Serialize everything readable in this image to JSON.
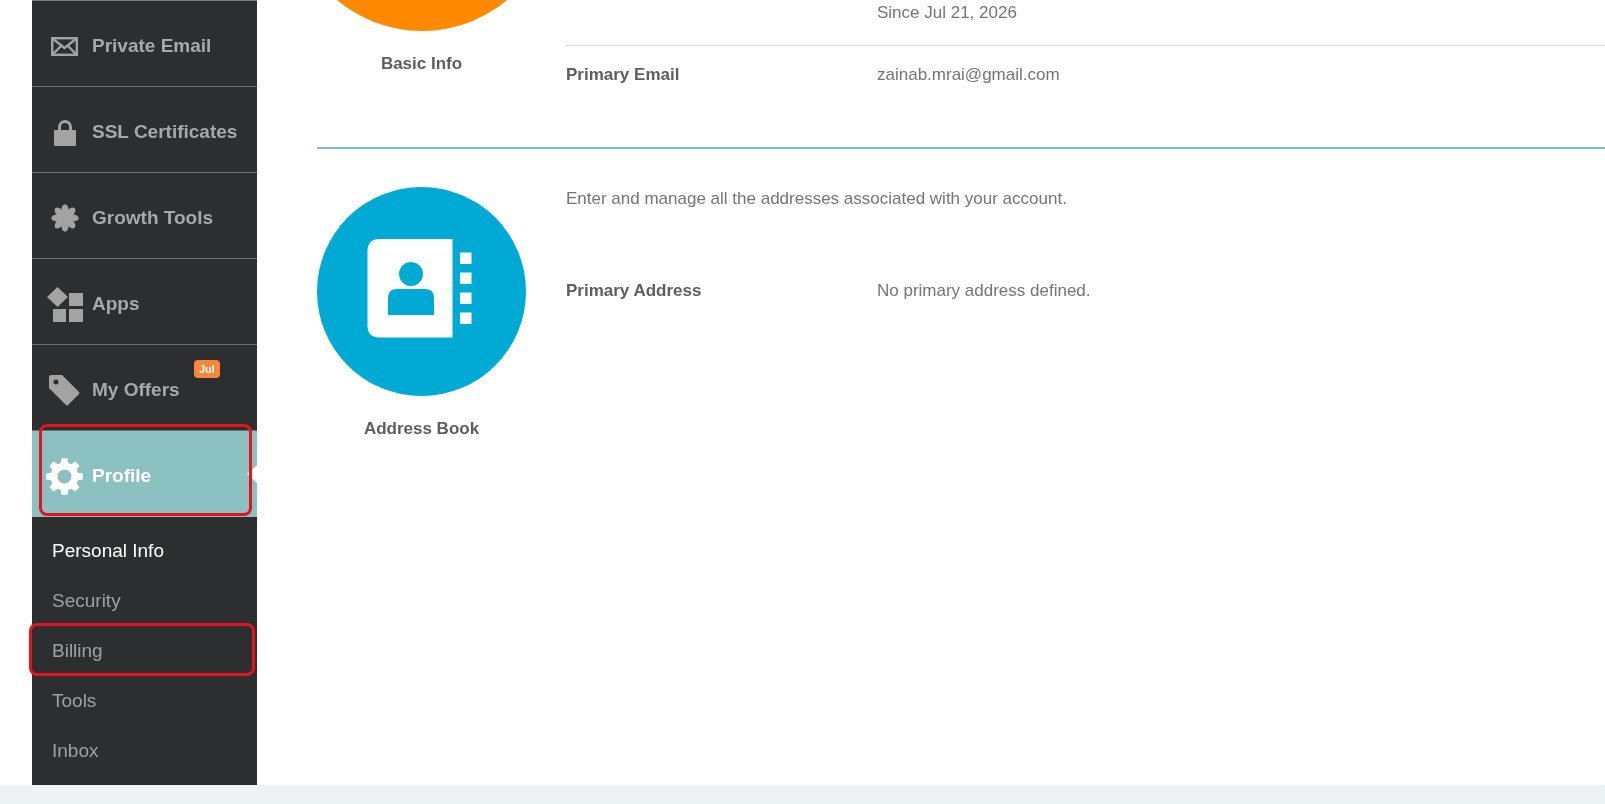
{
  "sidebar": {
    "items": [
      {
        "label": "Private Email",
        "selected": false,
        "highlighted": false
      },
      {
        "label": "SSL Certificates",
        "selected": false,
        "highlighted": false
      },
      {
        "label": "Growth Tools",
        "selected": false,
        "highlighted": false
      },
      {
        "label": "Apps",
        "selected": false,
        "highlighted": false
      },
      {
        "label": "My Offers",
        "badge": "Jul",
        "selected": false,
        "highlighted": false
      },
      {
        "label": "Profile",
        "selected": true,
        "highlighted": true
      }
    ],
    "submenu": [
      {
        "label": "Personal Info",
        "selected": true,
        "highlighted": false
      },
      {
        "label": "Security",
        "selected": false,
        "highlighted": false
      },
      {
        "label": "Billing",
        "selected": false,
        "highlighted": true
      },
      {
        "label": "Tools",
        "selected": false,
        "highlighted": false
      },
      {
        "label": "Inbox",
        "selected": false,
        "highlighted": false
      }
    ]
  },
  "sections": [
    {
      "title": "Basic Info",
      "color": "#ff8a00",
      "rows": [
        {
          "value": "Since Jul 21, 2026"
        },
        {
          "label": "Primary Email",
          "value": "zainab.mrai@gmail.com"
        }
      ]
    },
    {
      "title": "Address Book",
      "color": "#00aad5",
      "description": "Enter and manage all the addresses associated with your account.",
      "rows": [
        {
          "label": "Primary Address",
          "value": "No primary address defined."
        }
      ]
    }
  ]
}
